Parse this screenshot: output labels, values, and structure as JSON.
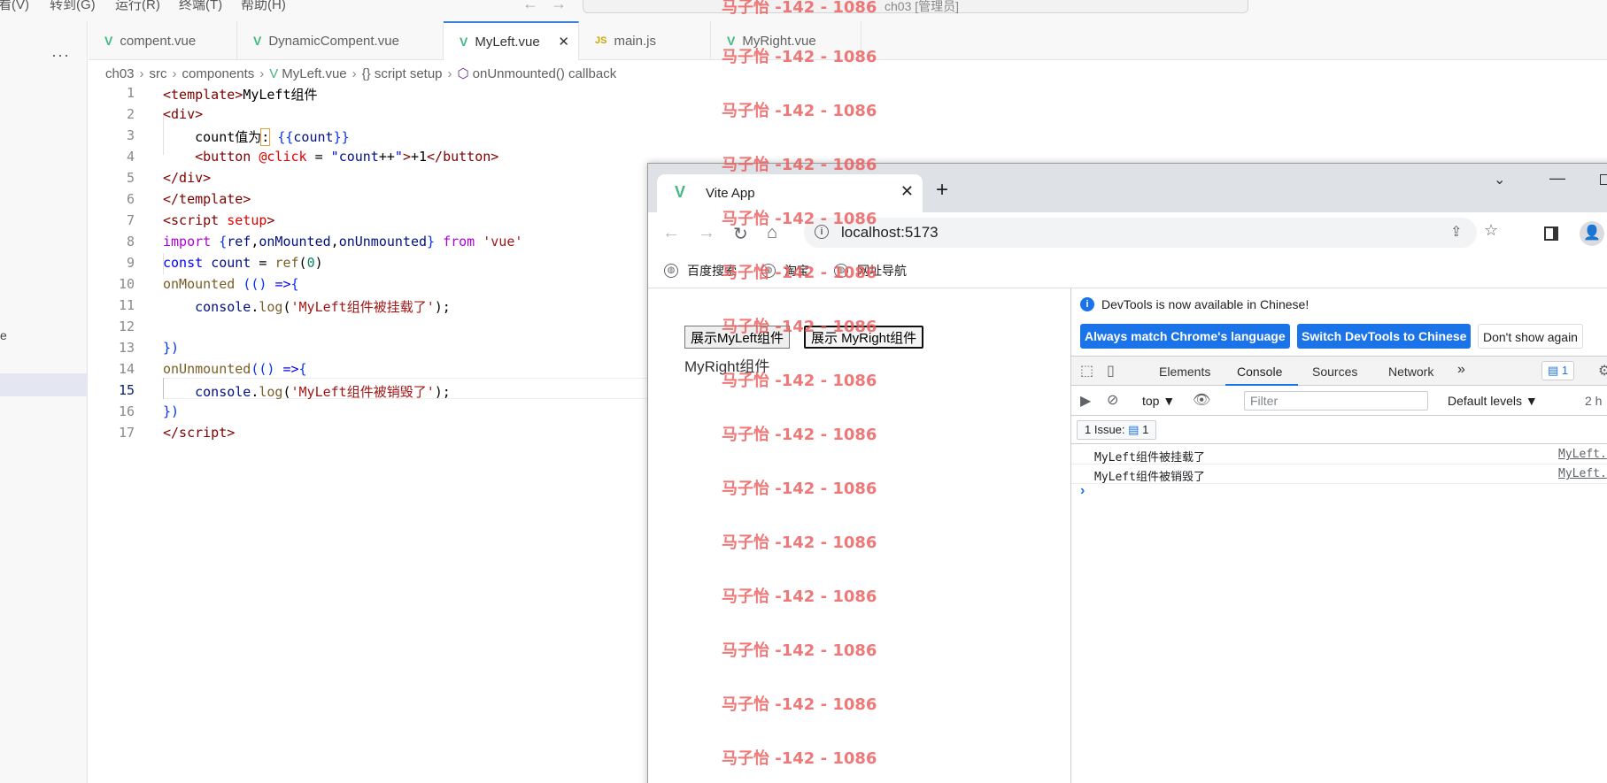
{
  "menubar": {
    "items": [
      "看(V)",
      "转到(G)",
      "运行(R)",
      "终端(T)",
      "帮助(H)"
    ],
    "search_text": "ch03 [管理员]"
  },
  "sidebar": {
    "partial_label": "e"
  },
  "editor_tabs": [
    {
      "label": "compent.vue",
      "icon": "vue-icon"
    },
    {
      "label": "DynamicCompent.vue",
      "icon": "vue-icon"
    },
    {
      "label": "MyLeft.vue",
      "icon": "vue-icon",
      "active": true
    },
    {
      "label": "main.js",
      "icon": "js-icon"
    },
    {
      "label": "MyRight.vue",
      "icon": "vue-icon"
    }
  ],
  "breadcrumb": [
    "ch03",
    "src",
    "components",
    "MyLeft.vue",
    "{} script setup",
    "onUnmounted() callback"
  ],
  "code": {
    "line_numbers": [
      "1",
      "2",
      "3",
      "4",
      "5",
      "6",
      "7",
      "8",
      "9",
      "10",
      "11",
      "12",
      "13",
      "14",
      "15",
      "16",
      "17"
    ],
    "current_line": 15
  },
  "browser": {
    "tab_title": "Vite App",
    "url": "localhost:5173",
    "bookmarks": [
      "百度搜索",
      "淘宝",
      "网址导航"
    ],
    "page": {
      "button_left": "展示MyLeft组件",
      "button_right": "展示 MyRight组件",
      "text": "MyRight组件"
    }
  },
  "devtools": {
    "info_text": "DevTools is now available in Chinese!",
    "btn_match": "Always match Chrome's language",
    "btn_switch": "Switch DevTools to Chinese",
    "btn_dismiss": "Don't show again",
    "tabs": [
      "Elements",
      "Console",
      "Sources",
      "Network"
    ],
    "more_tabs": "»",
    "issue_badge": "1",
    "context": "top ▼",
    "filter_placeholder": "Filter",
    "levels": "Default levels ▼",
    "hidden_partial": "2 h",
    "issues_pill": "1 Issue:",
    "issues_count": "1",
    "messages": [
      {
        "text": "MyLeft组件被挂载了",
        "source": "MyLeft."
      },
      {
        "text": "MyLeft组件被销毁了",
        "source": "MyLeft."
      }
    ],
    "prompt": "›"
  },
  "watermark": "马子怡 -142 - 1086",
  "colors": {
    "accent": "#1a73e8",
    "vue_green": "#41b883",
    "watermark": "#ec5a5a"
  }
}
